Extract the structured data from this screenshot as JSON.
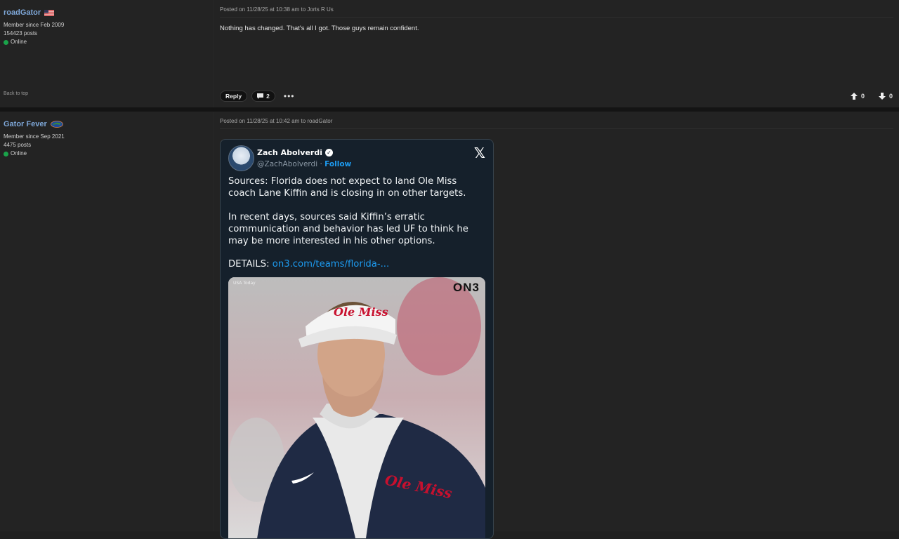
{
  "posts": [
    {
      "username": "roadGator",
      "member_since": "Member since Feb 2009",
      "posts_count": "154423 posts",
      "status": "Online",
      "posted": "Posted on 11/28/25 at 10:38 am to Jorts R Us",
      "body": "Nothing has changed. That's all I got. Those guys remain confident.",
      "back_to_top": "Back to top",
      "reply_label": "Reply",
      "comments_count": "2",
      "upvotes": "0",
      "downvotes": "0"
    },
    {
      "username": "Gator Fever",
      "member_since": "Member since Sep 2021",
      "posts_count": "4475 posts",
      "status": "Online",
      "posted": "Posted on 11/28/25 at 10:42 am to roadGator"
    }
  ],
  "tweet": {
    "author_name": "Zach Abolverdi",
    "handle": "@ZachAbolverdi",
    "separator": " · ",
    "follow": "Follow",
    "para1": "Sources: Florida does not expect to land Ole Miss coach Lane Kiffin and is closing in on other targets.",
    "para2": "In recent days, sources said Kiffin’s erratic communication and behavior has led UF to think he may be more interested in his other options.",
    "details_label": "DETAILS: ",
    "details_link": "on3.com/teams/florida-...",
    "image_credit": "USA Today",
    "image_logo": "ON3"
  },
  "icons": [
    "us-flag-icon",
    "gator-logo-icon",
    "comment-icon",
    "more-icon",
    "upvote-icon",
    "downvote-icon",
    "verified-icon",
    "x-logo-icon"
  ],
  "colors": {
    "background": "#232323",
    "username": "#7ea7d8",
    "online": "#1aa34a",
    "tweet_bg": "#15202b",
    "link": "#1d9bf0"
  }
}
